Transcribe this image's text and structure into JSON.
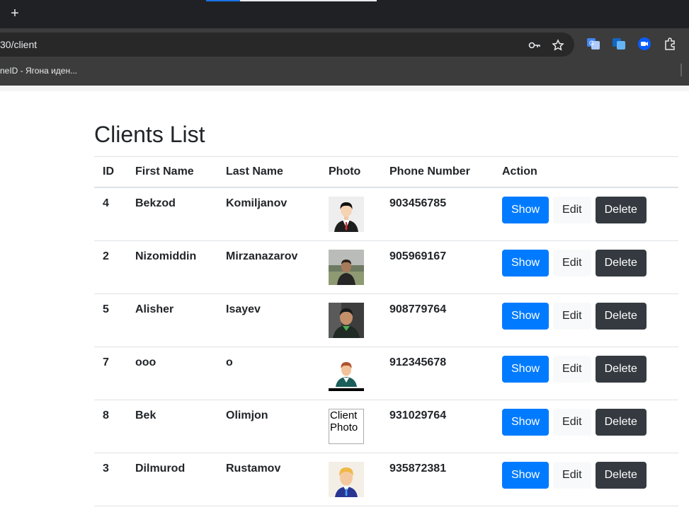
{
  "browser": {
    "new_tab_label": "+",
    "url": "30/client",
    "bookmark": "neID - Ягона иден..."
  },
  "page": {
    "title": "Clients List"
  },
  "table": {
    "headers": [
      "ID",
      "First Name",
      "Last Name",
      "Photo",
      "Phone Number",
      "Action"
    ],
    "rows": [
      {
        "id": "4",
        "first": "Bekzod",
        "last": "Komiljanov",
        "photo": "avatar-man-suit",
        "phone": "903456785"
      },
      {
        "id": "2",
        "first": "Nizomiddin",
        "last": "Mirzanazarov",
        "photo": "photo-man-outdoor",
        "phone": "905969167"
      },
      {
        "id": "5",
        "first": "Alisher",
        "last": "Isayev",
        "photo": "photo-man-portrait",
        "phone": "908779764"
      },
      {
        "id": "7",
        "first": "ooo",
        "last": "o",
        "photo": "avatar-man-cartoon",
        "phone": "912345678"
      },
      {
        "id": "8",
        "first": "Bek",
        "last": "Olimjon",
        "photo": "broken-image",
        "photo_alt": "Client Photo",
        "phone": "931029764"
      },
      {
        "id": "3",
        "first": "Dilmurod",
        "last": "Rustamov",
        "photo": "avatar-man-blond",
        "phone": "935872381"
      }
    ],
    "actions": {
      "show": "Show",
      "edit": "Edit",
      "delete": "Delete"
    }
  },
  "colors": {
    "primary": "#007bff",
    "light": "#f8f9fa",
    "dark": "#343a40"
  }
}
